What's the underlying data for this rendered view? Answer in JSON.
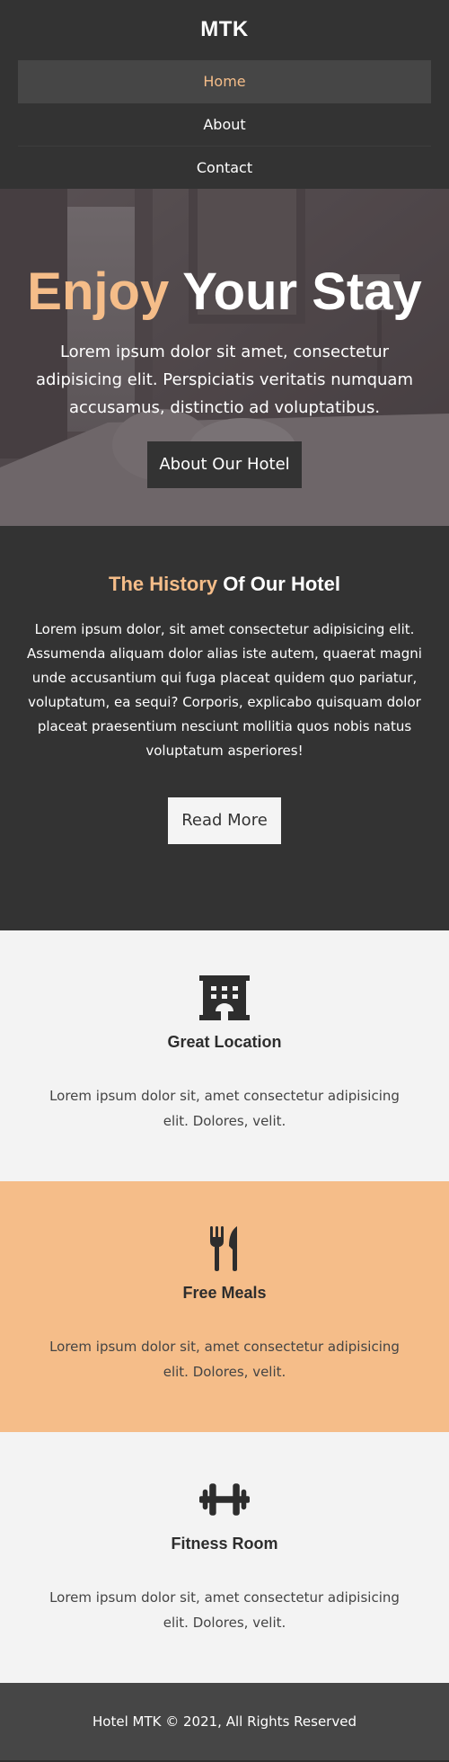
{
  "header": {
    "logo": "MTK",
    "nav": [
      {
        "label": "Home"
      },
      {
        "label": "About"
      },
      {
        "label": "Contact"
      }
    ]
  },
  "hero": {
    "title_accent": "Enjoy",
    "title_rest": "Your Stay",
    "text": "Lorem ipsum dolor sit amet, consectetur adipisicing elit. Perspiciatis veritatis numquam accusamus, distinctio ad voluptatibus.",
    "button": "About Our Hotel"
  },
  "history": {
    "title_accent": "The History",
    "title_rest": "Of Our Hotel",
    "text": "Lorem ipsum dolor, sit amet consectetur adipisicing elit. Assumenda aliquam dolor alias iste autem, quaerat magni unde accusantium qui fuga placeat quidem quo pariatur, voluptatum, ea sequi? Corporis, explicabo quisquam dolor placeat praesentium nesciunt mollitia quos nobis natus voluptatum asperiores!",
    "button": "Read More"
  },
  "features": [
    {
      "icon": "building-icon",
      "title": "Great Location",
      "text": "Lorem ipsum dolor sit, amet consectetur adipisicing elit. Dolores, velit."
    },
    {
      "icon": "utensils-icon",
      "title": "Free Meals",
      "text": "Lorem ipsum dolor sit, amet consectetur adipisicing elit. Dolores, velit."
    },
    {
      "icon": "dumbbell-icon",
      "title": "Fitness Room",
      "text": "Lorem ipsum dolor sit, amet consectetur adipisicing elit. Dolores, velit."
    }
  ],
  "footer": {
    "text": "Hotel MTK © 2021, All Rights Reserved"
  },
  "colors": {
    "accent": "#f5bd89",
    "dark": "#333333",
    "light": "#f3f3f3",
    "footer": "#464646"
  }
}
